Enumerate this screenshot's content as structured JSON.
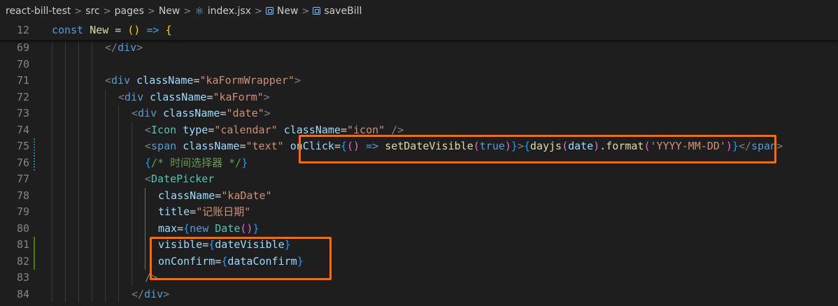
{
  "breadcrumb": {
    "items": [
      {
        "label": "react-bill-test",
        "icon": ""
      },
      {
        "label": "src",
        "icon": ""
      },
      {
        "label": "pages",
        "icon": ""
      },
      {
        "label": "New",
        "icon": ""
      },
      {
        "label": "index.jsx",
        "icon": "react-icon"
      },
      {
        "label": "New",
        "icon": "symbol-icon"
      },
      {
        "label": "saveBill",
        "icon": "symbol-icon"
      }
    ],
    "separator": ">"
  },
  "sticky": {
    "line_number": "12",
    "tokens": [
      {
        "t": "const ",
        "c": "kw"
      },
      {
        "t": "New",
        "c": "fn"
      },
      {
        "t": " = ",
        "c": "op"
      },
      {
        "t": "(",
        "c": "brace3"
      },
      {
        "t": ")",
        "c": "brace3"
      },
      {
        "t": " => ",
        "c": "kw"
      },
      {
        "t": "{",
        "c": "brace3"
      }
    ]
  },
  "editor": {
    "lines": [
      {
        "n": "69",
        "indent": 4,
        "gutter": "",
        "tokens": [
          {
            "t": "</",
            "c": "punc"
          },
          {
            "t": "div",
            "c": "tag"
          },
          {
            "t": ">",
            "c": "punc"
          }
        ]
      },
      {
        "n": "70",
        "indent": 0,
        "gutter": "",
        "tokens": []
      },
      {
        "n": "71",
        "indent": 4,
        "gutter": "",
        "tokens": [
          {
            "t": "<",
            "c": "punc"
          },
          {
            "t": "div",
            "c": "tag"
          },
          {
            "t": " ",
            "c": "op"
          },
          {
            "t": "className",
            "c": "attr"
          },
          {
            "t": "=",
            "c": "op"
          },
          {
            "t": "\"kaFormWrapper\"",
            "c": "str"
          },
          {
            "t": ">",
            "c": "punc"
          }
        ]
      },
      {
        "n": "72",
        "indent": 5,
        "gutter": "",
        "tokens": [
          {
            "t": "<",
            "c": "punc"
          },
          {
            "t": "div",
            "c": "tag"
          },
          {
            "t": " ",
            "c": "op"
          },
          {
            "t": "className",
            "c": "attr"
          },
          {
            "t": "=",
            "c": "op"
          },
          {
            "t": "\"kaForm\"",
            "c": "str"
          },
          {
            "t": ">",
            "c": "punc"
          }
        ]
      },
      {
        "n": "73",
        "indent": 6,
        "gutter": "",
        "tokens": [
          {
            "t": "<",
            "c": "punc"
          },
          {
            "t": "div",
            "c": "tag"
          },
          {
            "t": " ",
            "c": "op"
          },
          {
            "t": "className",
            "c": "attr"
          },
          {
            "t": "=",
            "c": "op"
          },
          {
            "t": "\"date\"",
            "c": "str"
          },
          {
            "t": ">",
            "c": "punc"
          }
        ]
      },
      {
        "n": "74",
        "indent": 7,
        "gutter": "",
        "tokens": [
          {
            "t": "<",
            "c": "punc"
          },
          {
            "t": "Icon",
            "c": "comp"
          },
          {
            "t": " ",
            "c": "op"
          },
          {
            "t": "type",
            "c": "attr"
          },
          {
            "t": "=",
            "c": "op"
          },
          {
            "t": "\"calendar\"",
            "c": "str"
          },
          {
            "t": " ",
            "c": "op"
          },
          {
            "t": "className",
            "c": "attr"
          },
          {
            "t": "=",
            "c": "op"
          },
          {
            "t": "\"icon\"",
            "c": "str"
          },
          {
            "t": " />",
            "c": "punc"
          }
        ]
      },
      {
        "n": "75",
        "indent": 7,
        "gutter": "modified",
        "tokens": [
          {
            "t": "<",
            "c": "punc"
          },
          {
            "t": "span",
            "c": "tag"
          },
          {
            "t": " ",
            "c": "op"
          },
          {
            "t": "className",
            "c": "attr"
          },
          {
            "t": "=",
            "c": "op"
          },
          {
            "t": "\"text\"",
            "c": "str"
          },
          {
            "t": " ",
            "c": "op"
          },
          {
            "t": "onClick",
            "c": "attr"
          },
          {
            "t": "=",
            "c": "op"
          },
          {
            "t": "{",
            "c": "brace2"
          },
          {
            "t": "()",
            "c": "brace"
          },
          {
            "t": " => ",
            "c": "kw"
          },
          {
            "t": "setDateVisible",
            "c": "fn"
          },
          {
            "t": "(",
            "c": "brace"
          },
          {
            "t": "true",
            "c": "kw"
          },
          {
            "t": ")",
            "c": "brace"
          },
          {
            "t": "}",
            "c": "brace2"
          },
          {
            "t": ">",
            "c": "punc"
          },
          {
            "t": "{",
            "c": "brace2"
          },
          {
            "t": "dayjs",
            "c": "fn"
          },
          {
            "t": "(",
            "c": "brace"
          },
          {
            "t": "date",
            "c": "var"
          },
          {
            "t": ")",
            "c": "brace"
          },
          {
            "t": ".",
            "c": "op"
          },
          {
            "t": "format",
            "c": "fn"
          },
          {
            "t": "(",
            "c": "brace"
          },
          {
            "t": "'YYYY-MM-DD'",
            "c": "str"
          },
          {
            "t": ")",
            "c": "brace"
          },
          {
            "t": "}",
            "c": "brace2"
          },
          {
            "t": "</",
            "c": "punc"
          },
          {
            "t": "span",
            "c": "tag"
          },
          {
            "t": ">",
            "c": "punc"
          }
        ]
      },
      {
        "n": "76",
        "indent": 7,
        "gutter": "modified",
        "tokens": [
          {
            "t": "{",
            "c": "brace2"
          },
          {
            "t": "/* 时间选择器 */",
            "c": "cm"
          },
          {
            "t": "}",
            "c": "brace2"
          }
        ]
      },
      {
        "n": "77",
        "indent": 7,
        "gutter": "",
        "tokens": [
          {
            "t": "<",
            "c": "punc"
          },
          {
            "t": "DatePicker",
            "c": "comp"
          }
        ]
      },
      {
        "n": "78",
        "indent": 8,
        "gutter": "",
        "tokens": [
          {
            "t": "className",
            "c": "attr"
          },
          {
            "t": "=",
            "c": "op"
          },
          {
            "t": "\"kaDate\"",
            "c": "str"
          }
        ]
      },
      {
        "n": "79",
        "indent": 8,
        "gutter": "",
        "tokens": [
          {
            "t": "title",
            "c": "attr"
          },
          {
            "t": "=",
            "c": "op"
          },
          {
            "t": "\"记账日期\"",
            "c": "str"
          }
        ]
      },
      {
        "n": "80",
        "indent": 8,
        "gutter": "",
        "tokens": [
          {
            "t": "max",
            "c": "attr"
          },
          {
            "t": "=",
            "c": "op"
          },
          {
            "t": "{",
            "c": "brace2"
          },
          {
            "t": "new",
            "c": "kw"
          },
          {
            "t": " ",
            "c": "op"
          },
          {
            "t": "Date",
            "c": "comp"
          },
          {
            "t": "()",
            "c": "brace"
          },
          {
            "t": "}",
            "c": "brace2"
          }
        ]
      },
      {
        "n": "81",
        "indent": 8,
        "gutter": "added",
        "tokens": [
          {
            "t": "visible",
            "c": "attr"
          },
          {
            "t": "=",
            "c": "op"
          },
          {
            "t": "{",
            "c": "brace2"
          },
          {
            "t": "dateVisible",
            "c": "var"
          },
          {
            "t": "}",
            "c": "brace2"
          }
        ]
      },
      {
        "n": "82",
        "indent": 8,
        "gutter": "added",
        "tokens": [
          {
            "t": "onConfirm",
            "c": "attr"
          },
          {
            "t": "=",
            "c": "op"
          },
          {
            "t": "{",
            "c": "brace2"
          },
          {
            "t": "dataConfirm",
            "c": "var"
          },
          {
            "t": "}",
            "c": "brace2"
          }
        ]
      },
      {
        "n": "83",
        "indent": 7,
        "gutter": "",
        "tokens": [
          {
            "t": "/>",
            "c": "punc"
          }
        ]
      },
      {
        "n": "84",
        "indent": 6,
        "gutter": "",
        "tokens": [
          {
            "t": "</",
            "c": "punc"
          },
          {
            "t": "div",
            "c": "tag"
          },
          {
            "t": ">",
            "c": "punc"
          }
        ]
      }
    ]
  },
  "highlights": [
    {
      "name": "onclick-highlight-box",
      "color": "#ff6a00"
    },
    {
      "name": "props-highlight-box",
      "color": "#ff6a00"
    }
  ]
}
